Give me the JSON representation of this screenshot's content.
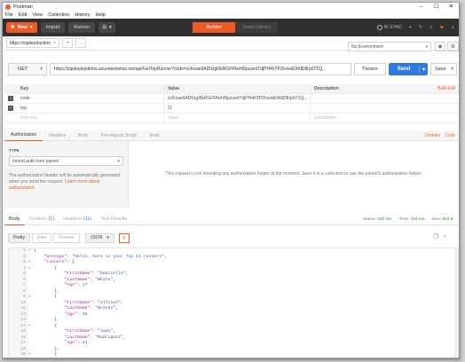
{
  "window": {
    "title": "Postman"
  },
  "menu": [
    "File",
    "Edit",
    "View",
    "Collection",
    "History",
    "Help"
  ],
  "toolbar": {
    "new_label": "New",
    "import_label": "Import",
    "runner_label": "Runner",
    "builder_label": "Builder",
    "team_library_label": "Team Library",
    "in_sync_label": "IN SYNC"
  },
  "request_tab": {
    "title": "https://zipdeploydem",
    "add": "+",
    "more": "···"
  },
  "environment": {
    "selected": "No Environment"
  },
  "request": {
    "method": "GET",
    "url": "https://zipdeploydemo.azurewebsites.net/api/GetTopRunner?code=zcKeae9AD0zgl5kRGFRfwhf9pzavdTdjPH4hTPZioxwEWdD8rp071Q...",
    "params_label": "Params",
    "send_label": "Send",
    "save_label": "Save"
  },
  "params_table": {
    "headers": {
      "key": "Key",
      "value": "Value",
      "description": "Description",
      "bulk_edit": "Bulk Edit"
    },
    "rows": [
      {
        "key": "code",
        "value": "zcKeae9AD0zgl5kRGFRfwhf9pzavdTdjPH4hTPZioxwEWdD8rp071Q..."
      },
      {
        "key": "top",
        "value": "11"
      }
    ],
    "placeholders": {
      "key": "New key",
      "value": "Value",
      "description": "Description"
    }
  },
  "request_subtabs": {
    "tabs": [
      "Authorization",
      "Headers",
      "Body",
      "Pre-request Script",
      "Tests"
    ],
    "cookies": "Cookies",
    "code": "Code"
  },
  "auth": {
    "type_label": "TYPE",
    "type_value": "Inherit auth from parent",
    "note": "The authorization header will be automatically generated when you send the request.",
    "learn_more": "Learn more about authorization",
    "message": "This request is not inheriting any authorization helper at the moment. Save it in a collection to use the parent's authorization helper."
  },
  "response_tabs": {
    "body": "Body",
    "cookies": "Cookies",
    "cookies_count": "(1)",
    "headers": "Headers",
    "headers_count": "(11)",
    "test_results": "Test Results"
  },
  "response_status": {
    "status_label": "Status:",
    "status": "200 OK",
    "time_label": "Time:",
    "time": "222 ms",
    "size_label": "Size:",
    "size": "816 B"
  },
  "response_view": {
    "pretty": "Pretty",
    "raw": "Raw",
    "preview": "Preview",
    "format": "JSON"
  },
  "code_lines": [
    {
      "n": "1",
      "t": "{"
    },
    {
      "n": "2",
      "t": "    \"message\": \"Hello, here is your Top 11 runners\","
    },
    {
      "n": "3",
      "t": "    \"runners\": ["
    },
    {
      "n": "4",
      "t": "        {"
    },
    {
      "n": "5",
      "t": "            \"FirstName\": \"Gabrielle\","
    },
    {
      "n": "6",
      "t": "            \"LastName\": \"White\","
    },
    {
      "n": "7",
      "t": "            \"Age\": 17"
    },
    {
      "n": "8",
      "t": "        },"
    },
    {
      "n": "9",
      "t": "        {"
    },
    {
      "n": "10",
      "t": "            \"FirstName\": \"Allison\","
    },
    {
      "n": "11",
      "t": "            \"LastName\": \"Brooks\","
    },
    {
      "n": "12",
      "t": "            \"Age\": 36"
    },
    {
      "n": "13",
      "t": "        },"
    },
    {
      "n": "14",
      "t": "        {"
    },
    {
      "n": "15",
      "t": "            \"FirstName\": \"Juan\","
    },
    {
      "n": "16",
      "t": "            \"LastName\": \"Rodriguez\","
    },
    {
      "n": "17",
      "t": "            \"Age\": 21"
    },
    {
      "n": "18",
      "t": "        },"
    },
    {
      "n": "19",
      "t": "        {"
    }
  ]
}
